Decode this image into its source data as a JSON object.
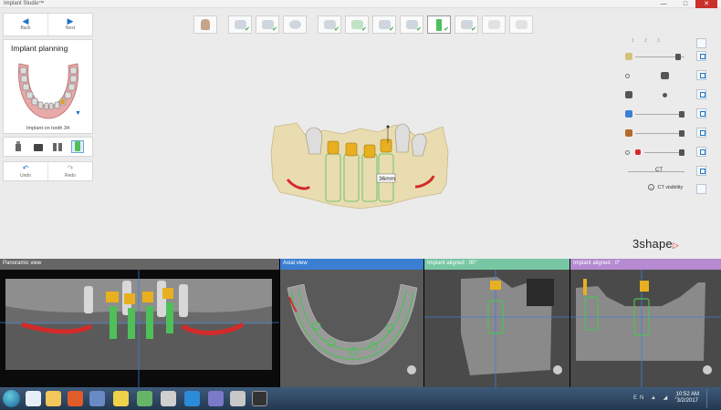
{
  "window": {
    "title": "Implant Studio™",
    "minimize": "—",
    "maximize": "□",
    "close": "✕"
  },
  "nav": {
    "back_label": "Back",
    "next_label": "Next",
    "back_icon": "arrow-left-icon",
    "next_icon": "arrow-right-icon"
  },
  "planning": {
    "title": "Implant planning",
    "caption": "Implant on tooth 34"
  },
  "edit": {
    "undo_label": "Undo",
    "redo_label": "Redo"
  },
  "toolbar_steps": [
    {
      "icon": "patient-icon",
      "done": false
    },
    {
      "icon": "scan-import-icon",
      "done": true
    },
    {
      "icon": "ct-import-icon",
      "done": true
    },
    {
      "icon": "segmentation-icon",
      "done": false
    },
    {
      "icon": "scan-align-icon",
      "done": true
    },
    {
      "icon": "jaw-icon",
      "done": true
    },
    {
      "icon": "nerve-icon",
      "done": true
    },
    {
      "icon": "tooth-design-icon",
      "done": true
    },
    {
      "icon": "implant-icon",
      "done": true,
      "current": true
    },
    {
      "icon": "sleeve-icon",
      "done": true
    },
    {
      "icon": "guide-icon",
      "done": false
    },
    {
      "icon": "export-icon",
      "done": false
    }
  ],
  "right_panel": {
    "top_numbers": [
      "1",
      "2",
      "3"
    ],
    "ct_visibility_label": "CT visibility",
    "ct_label": "CT"
  },
  "measurement": "36mm",
  "brand": {
    "name": "3shape",
    "mark": "▷"
  },
  "viewports": {
    "panoramic": "Panoramic view",
    "axial": "Axial view",
    "aligned90": "Implant aligned : 90°",
    "aligned0": "Implant aligned : 0°"
  },
  "colors": {
    "nerve": "#d42a2a",
    "implant": "#4fbf5a",
    "crown": "#e8b020",
    "panoramic_header": "#666666",
    "axial_header": "#3b7fd3",
    "aligned90_header": "#78c7a4",
    "aligned0_header": "#b58ad0",
    "bone": "#e9dcb0"
  },
  "taskbar": {
    "time": "10:52 AM",
    "date": "3/2/2017",
    "lang": "EN"
  }
}
